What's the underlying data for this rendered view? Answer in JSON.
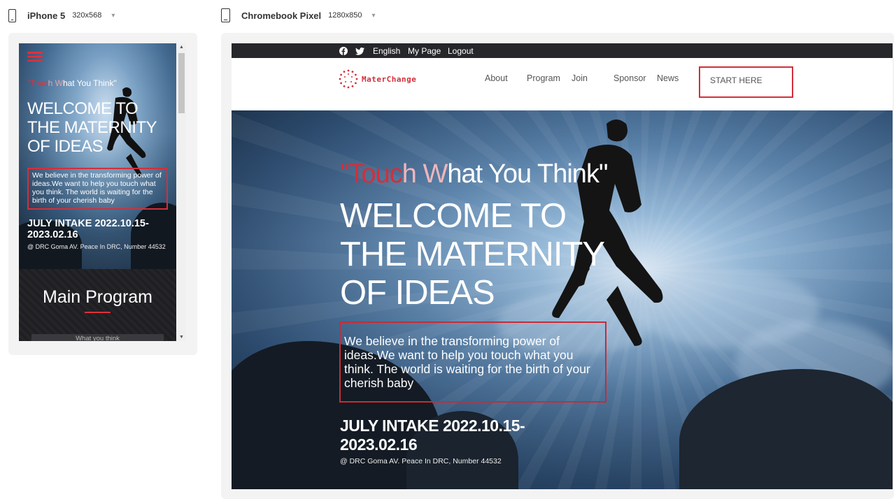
{
  "devices": {
    "iphone": {
      "name": "iPhone 5",
      "size": "320x568"
    },
    "chromebook": {
      "name": "Chromebook Pixel",
      "size": "1280x850"
    }
  },
  "topbar": {
    "icons": [
      "facebook-icon",
      "twitter-icon"
    ],
    "links": [
      "English",
      "My Page",
      "Logout"
    ]
  },
  "brand": {
    "logo_text": "MaterChange"
  },
  "nav": {
    "items": [
      "About",
      "Program",
      "Join",
      "Sponsor",
      "News"
    ],
    "cta": "START HERE"
  },
  "hero": {
    "quote_open": "\"Touc",
    "quote_h": "h W",
    "quote_rest": "hat You Think\"",
    "title": "WELCOME TO THE MATERNITY OF IDEAS",
    "mobile_title": "WELCOME TO THE MATERNITY OF IDEAS",
    "description": "We believe in the transforming power of ideas.We want to help you touch what you think. The world is waiting for the birth of your cherish baby",
    "intake": "JULY INTAKE 2022.10.15-2023.02.16",
    "address": "@ DRC Goma AV. Peace In DRC, Number 44532"
  },
  "mobile": {
    "program_title": "Main Program",
    "program_card": "What you think"
  },
  "colors": {
    "accent": "#d32f3a",
    "topbar_bg": "#26272b",
    "panel_bg": "#f3f3f3"
  }
}
